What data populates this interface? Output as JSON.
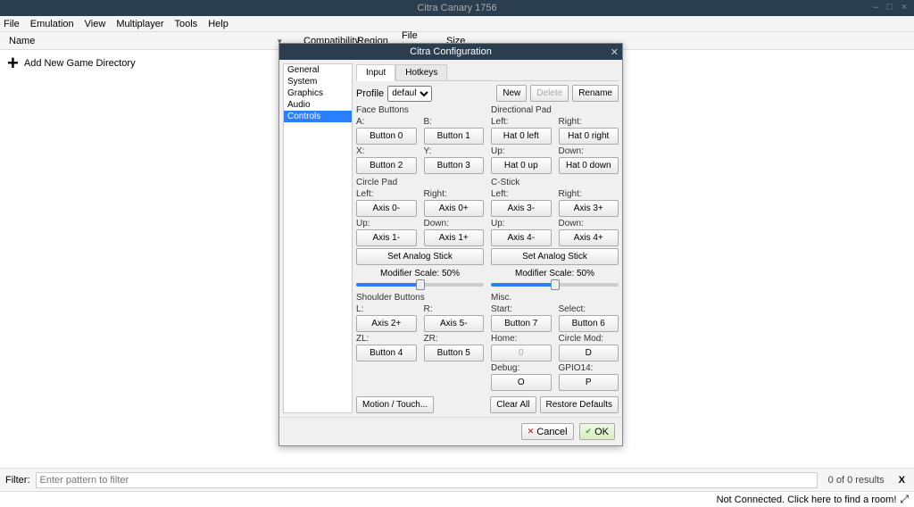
{
  "window": {
    "title": "Citra Canary 1756"
  },
  "menubar": [
    "File",
    "Emulation",
    "View",
    "Multiplayer",
    "Tools",
    "Help"
  ],
  "columns": {
    "name": "Name",
    "compat": "Compatibility",
    "region": "Region",
    "filetype": "File type",
    "size": "Size"
  },
  "add_dir_label": "Add New Game Directory",
  "filter": {
    "label": "Filter:",
    "placeholder": "Enter pattern to filter",
    "results": "0 of 0 results"
  },
  "statusbar": "Not Connected. Click here to find a room!",
  "dialog": {
    "title": "Citra Configuration",
    "sidebar": [
      "General",
      "System",
      "Graphics",
      "Audio",
      "Controls"
    ],
    "tabs": [
      "Input",
      "Hotkeys"
    ],
    "profile": {
      "label": "Profile",
      "selected": "default",
      "new": "New",
      "delete": "Delete",
      "rename": "Rename"
    },
    "face_buttons": {
      "title": "Face Buttons",
      "a": {
        "label": "A:",
        "map": "Button 0"
      },
      "b": {
        "label": "B:",
        "map": "Button 1"
      },
      "x": {
        "label": "X:",
        "map": "Button 2"
      },
      "y": {
        "label": "Y:",
        "map": "Button 3"
      }
    },
    "dpad": {
      "title": "Directional Pad",
      "left": {
        "label": "Left:",
        "map": "Hat 0 left"
      },
      "right": {
        "label": "Right:",
        "map": "Hat 0 right"
      },
      "up": {
        "label": "Up:",
        "map": "Hat 0 up"
      },
      "down": {
        "label": "Down:",
        "map": "Hat 0 down"
      }
    },
    "circle_pad": {
      "title": "Circle Pad",
      "left": {
        "label": "Left:",
        "map": "Axis 0-"
      },
      "right": {
        "label": "Right:",
        "map": "Axis 0+"
      },
      "up": {
        "label": "Up:",
        "map": "Axis 1-"
      },
      "down": {
        "label": "Down:",
        "map": "Axis 1+"
      },
      "analog": "Set Analog Stick",
      "modifier": "Modifier Scale: 50%"
    },
    "cstick": {
      "title": "C-Stick",
      "left": {
        "label": "Left:",
        "map": "Axis 3-"
      },
      "right": {
        "label": "Right:",
        "map": "Axis 3+"
      },
      "up": {
        "label": "Up:",
        "map": "Axis 4-"
      },
      "down": {
        "label": "Down:",
        "map": "Axis 4+"
      },
      "analog": "Set Analog Stick",
      "modifier": "Modifier Scale: 50%"
    },
    "shoulder": {
      "title": "Shoulder Buttons",
      "l": {
        "label": "L:",
        "map": "Axis 2+"
      },
      "r": {
        "label": "R:",
        "map": "Axis 5-"
      },
      "zl": {
        "label": "ZL:",
        "map": "Button 4"
      },
      "zr": {
        "label": "ZR:",
        "map": "Button 5"
      }
    },
    "misc": {
      "title": "Misc.",
      "start": {
        "label": "Start:",
        "map": "Button 7"
      },
      "select": {
        "label": "Select:",
        "map": "Button 6"
      },
      "home": {
        "label": "Home:",
        "map": "0"
      },
      "cmod": {
        "label": "Circle Mod:",
        "map": "D"
      },
      "debug": {
        "label": "Debug:",
        "map": "O"
      },
      "gpio": {
        "label": "GPIO14:",
        "map": "P"
      }
    },
    "motion": "Motion / Touch...",
    "clear_all": "Clear All",
    "restore_defaults": "Restore Defaults",
    "cancel": "Cancel",
    "ok": "OK"
  }
}
